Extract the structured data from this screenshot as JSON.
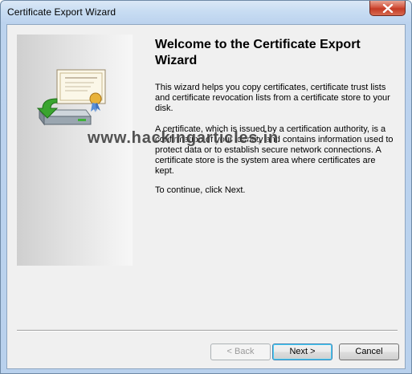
{
  "window": {
    "title": "Certificate Export Wizard",
    "close_icon": "close-icon"
  },
  "content": {
    "heading": "Welcome to the Certificate Export Wizard",
    "paragraph_1": "This wizard helps you copy certificates, certificate trust lists and certificate revocation lists from a certificate store to your disk.",
    "paragraph_2": "A certificate, which is issued by a certification authority, is a confirmation of your identity and contains information used to protect data or to establish secure network connections. A certificate store is the system area where certificates are kept.",
    "paragraph_3": "To continue, click Next.",
    "watermark": "www.hackingarticles.in",
    "side_icon": "certificate-export-icon"
  },
  "buttons": {
    "back": "< Back",
    "next": "Next >",
    "cancel": "Cancel"
  },
  "colors": {
    "accent_green": "#3aa52f",
    "close_red": "#c43a25"
  }
}
